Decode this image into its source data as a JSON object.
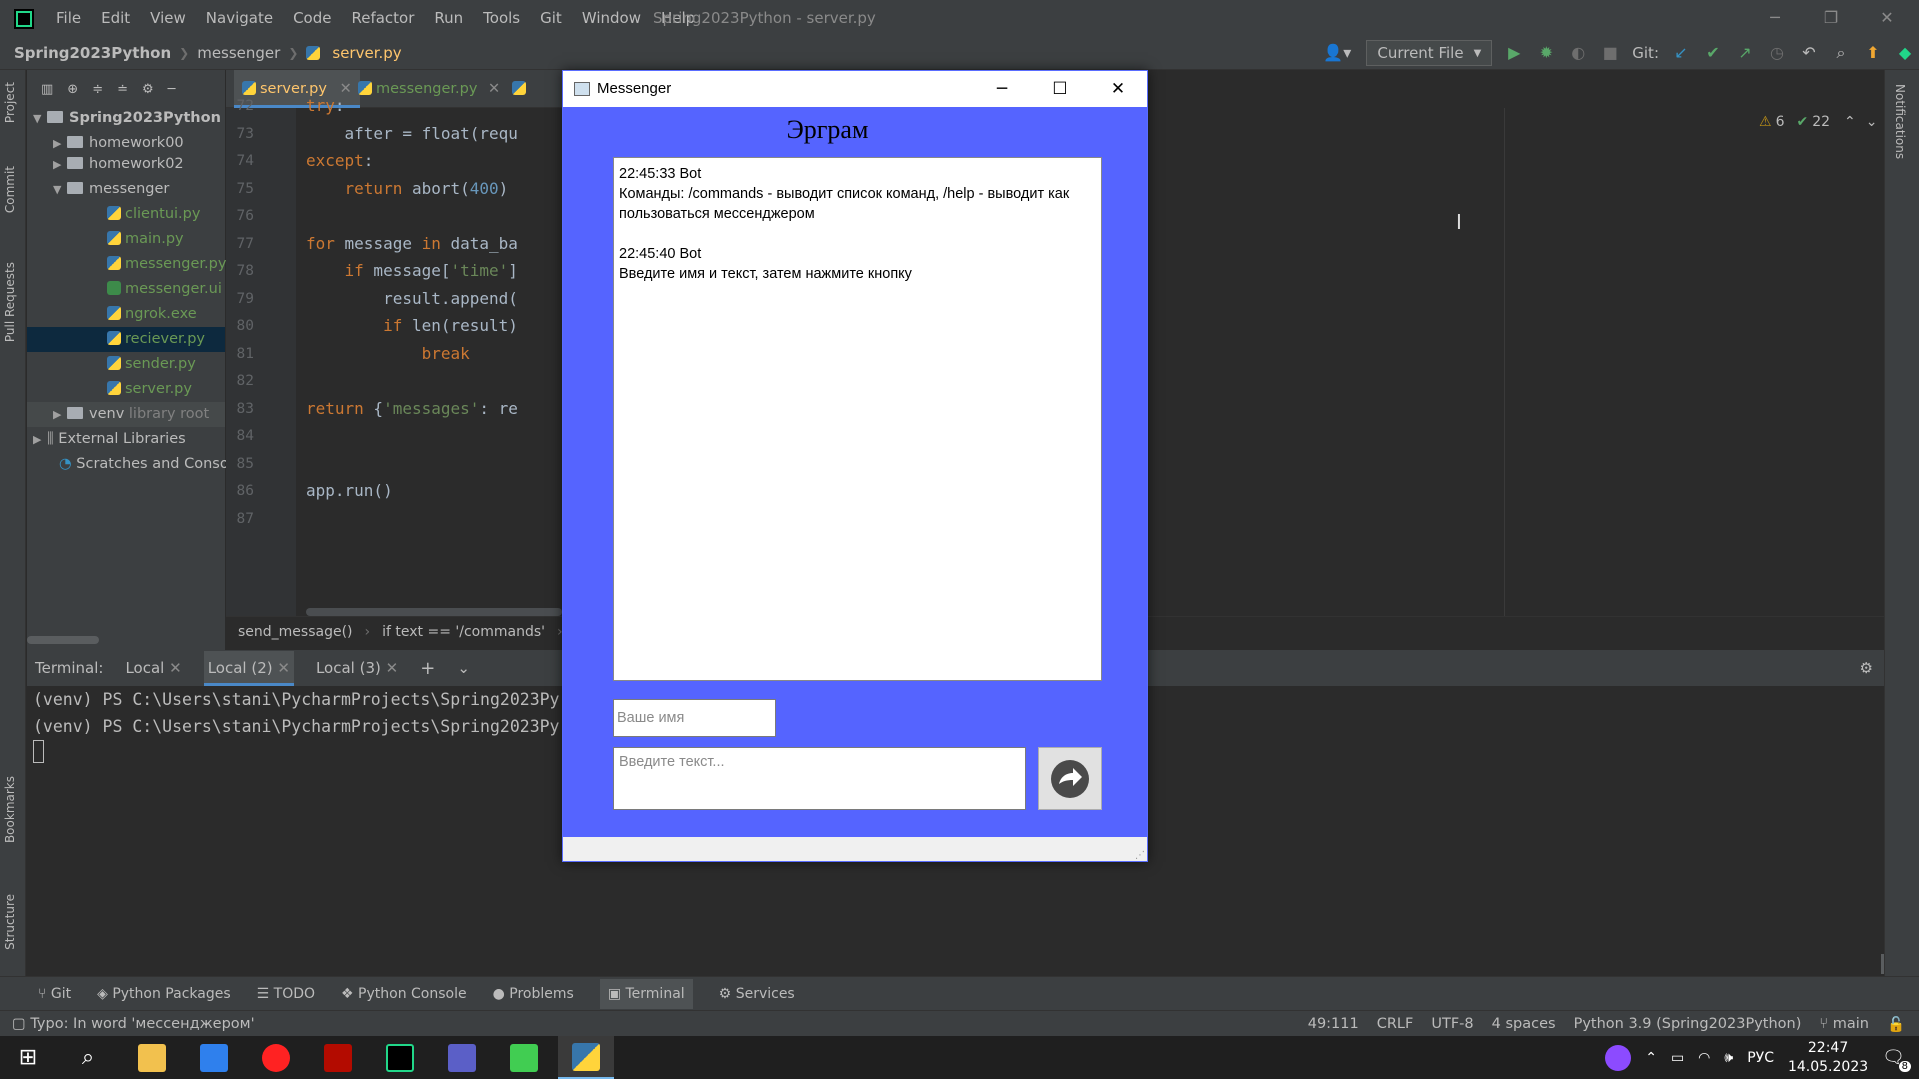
{
  "ide": {
    "window_title": "Spring2023Python - server.py",
    "menu": [
      "File",
      "Edit",
      "View",
      "Navigate",
      "Code",
      "Refactor",
      "Run",
      "Tools",
      "Git",
      "Window",
      "Help"
    ],
    "breadcrumbs": [
      "Spring2023Python",
      "messenger",
      "server.py"
    ],
    "run_config": "Current File",
    "git_label": "Git:"
  },
  "tool_strip_left": [
    "Project",
    "Commit",
    "Pull Requests",
    "Bookmarks",
    "Structure"
  ],
  "tool_strip_right": [
    "Notifications"
  ],
  "project_tree": {
    "root": "Spring2023Python",
    "root_suffix": "C",
    "items": [
      {
        "label": "homework00",
        "type": "folder"
      },
      {
        "label": "homework02",
        "type": "folder"
      },
      {
        "label": "messenger",
        "type": "folder"
      },
      {
        "label": "clientui.py",
        "type": "py"
      },
      {
        "label": "main.py",
        "type": "py"
      },
      {
        "label": "messenger.py",
        "type": "py"
      },
      {
        "label": "messenger.ui",
        "type": "ui"
      },
      {
        "label": "ngrok.exe",
        "type": "exe"
      },
      {
        "label": "reciever.py",
        "type": "py"
      },
      {
        "label": "sender.py",
        "type": "py"
      },
      {
        "label": "server.py",
        "type": "py"
      },
      {
        "label": "venv",
        "type": "folder",
        "suffix": "library root"
      },
      {
        "label": "External Libraries",
        "type": "lib"
      },
      {
        "label": "Scratches and Console",
        "type": "scratch"
      }
    ]
  },
  "editor_tabs": [
    "server.py",
    "messenger.py",
    "clie"
  ],
  "editor": {
    "lines": [
      {
        "n": "72",
        "code": "try:"
      },
      {
        "n": "73",
        "code": "    after = float(requ"
      },
      {
        "n": "74",
        "code": "except:"
      },
      {
        "n": "75",
        "code": "    return abort(400)"
      },
      {
        "n": "76",
        "code": ""
      },
      {
        "n": "77",
        "code": "for message in data_ba"
      },
      {
        "n": "78",
        "code": "    if message['time']"
      },
      {
        "n": "79",
        "code": "        result.append("
      },
      {
        "n": "80",
        "code": "        if len(result)"
      },
      {
        "n": "81",
        "code": "            break"
      },
      {
        "n": "82",
        "code": ""
      },
      {
        "n": "83",
        "code": "return {'messages': re"
      },
      {
        "n": "84",
        "code": ""
      },
      {
        "n": "85",
        "code": ""
      },
      {
        "n": "86",
        "code": "app.run()"
      },
      {
        "n": "87",
        "code": ""
      }
    ],
    "inspections": {
      "warnings": "6",
      "ok": "22"
    },
    "path_crumbs": [
      "send_message()",
      "if text == '/commands'",
      "'t"
    ]
  },
  "terminal": {
    "label": "Terminal:",
    "tabs": [
      "Local",
      "Local (2)",
      "Local (3)"
    ],
    "lines": [
      "(venv) PS C:\\Users\\stani\\PycharmProjects\\Spring2023Py",
      "(venv) PS C:\\Users\\stani\\PycharmProjects\\Spring2023Py"
    ]
  },
  "bottom_tools": [
    "Git",
    "Python Packages",
    "TODO",
    "Python Console",
    "Problems",
    "Terminal",
    "Services"
  ],
  "status": {
    "message": "Typo: In word 'мессенджером'",
    "position": "49:111",
    "line_sep": "CRLF",
    "encoding": "UTF-8",
    "indent": "4 spaces",
    "interpreter": "Python 3.9 (Spring2023Python)",
    "branch": "main"
  },
  "messenger": {
    "window_title": "Messenger",
    "heading": "Эрграм",
    "messages": [
      {
        "header": "22:45:33 Bot",
        "text": "Команды: /commands - выводит список команд, /help - выводит как пользоваться мессенджером"
      },
      {
        "header": "22:45:40 Bot",
        "text": "Введите имя и текст, затем нажмите кнопку"
      }
    ],
    "name_placeholder": "Ваше имя",
    "text_placeholder": "Введите текст...",
    "send_icon": "arrow-right-icon",
    "accent_color": "#5564ff"
  },
  "taskbar": {
    "lang": "РУС",
    "time": "22:47",
    "date": "14.05.2023",
    "notification_count": "8"
  }
}
